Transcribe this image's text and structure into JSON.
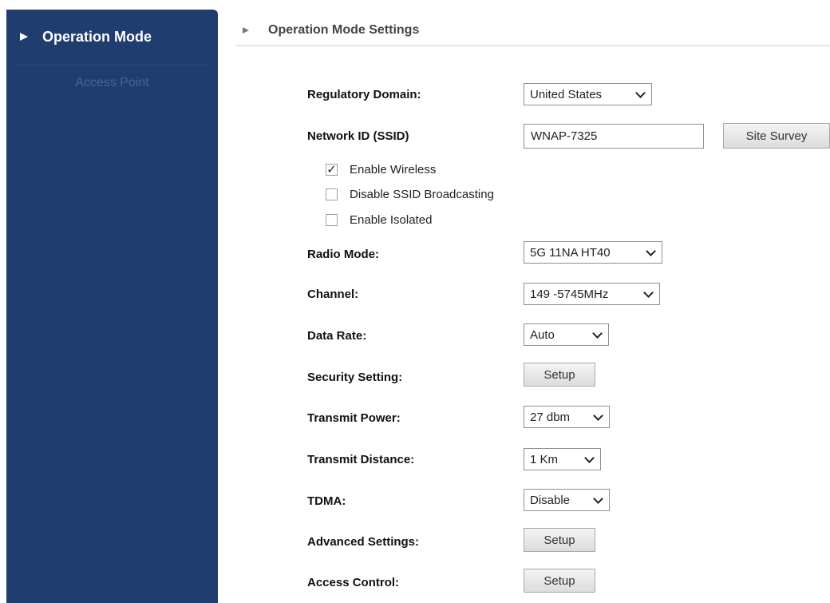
{
  "sidebar": {
    "header_label": "Operation Mode",
    "items": [
      {
        "label": "Access Point"
      }
    ]
  },
  "page": {
    "title": "Operation Mode Settings"
  },
  "form": {
    "regulatory_domain": {
      "label": "Regulatory Domain:",
      "value": "United States"
    },
    "ssid": {
      "label": "Network ID (SSID)",
      "value": "WNAP-7325",
      "site_survey_label": "Site Survey"
    },
    "checkboxes": [
      {
        "label": "Enable Wireless",
        "checked": true,
        "mark": "✓"
      },
      {
        "label": "Disable SSID Broadcasting",
        "checked": false
      },
      {
        "label": "Enable Isolated",
        "checked": false
      }
    ],
    "radio_mode": {
      "label": "Radio Mode:",
      "value": "5G 11NA HT40"
    },
    "channel": {
      "label": "Channel:",
      "value": "149 -5745MHz"
    },
    "data_rate": {
      "label": "Data Rate:",
      "value": "Auto"
    },
    "security_setting": {
      "label": "Security Setting:",
      "button": "Setup"
    },
    "transmit_power": {
      "label": "Transmit Power:",
      "value": "27 dbm"
    },
    "transmit_distance": {
      "label": "Transmit Distance:",
      "value": "1 Km"
    },
    "tdma": {
      "label": "TDMA:",
      "value": "Disable"
    },
    "advanced_settings": {
      "label": "Advanced Settings:",
      "button": "Setup"
    },
    "access_control": {
      "label": "Access Control:",
      "button": "Setup"
    }
  },
  "colors": {
    "sidebar_bg": "#1f3d6e",
    "sidebar_sub_text": "#4a6496",
    "header_rule": "#e4e4e4"
  }
}
